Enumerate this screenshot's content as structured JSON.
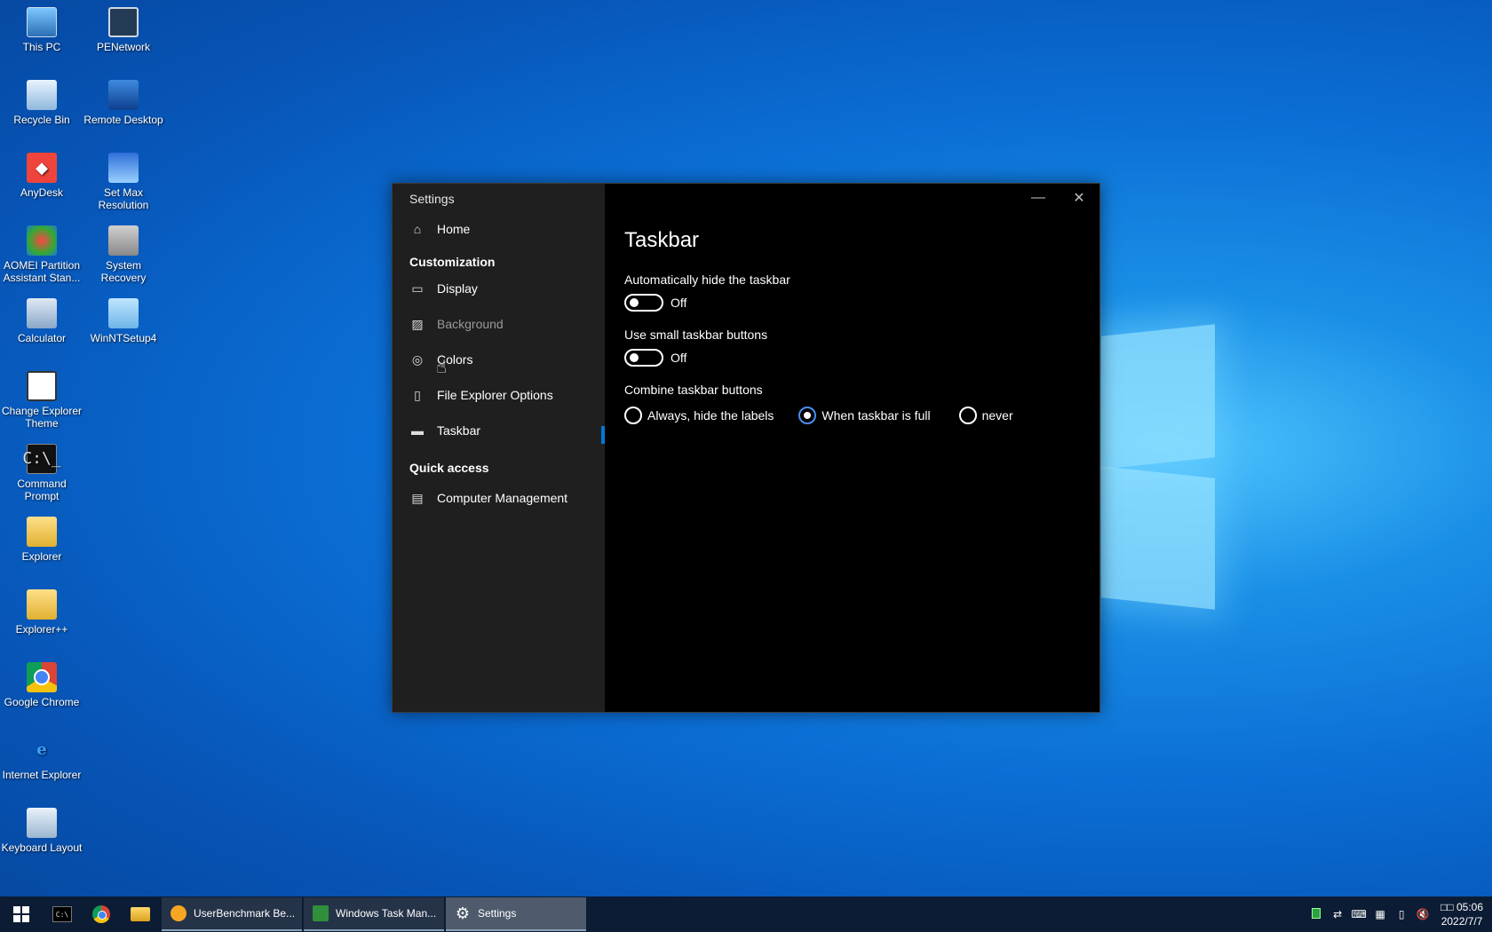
{
  "desktop": {
    "icons": [
      {
        "label": "This PC",
        "icon": "computer-icon"
      },
      {
        "label": "PENetwork",
        "icon": "network-icon"
      },
      {
        "label": "Recycle Bin",
        "icon": "recycle-bin-icon"
      },
      {
        "label": "Remote Desktop",
        "icon": "remote-desktop-icon"
      },
      {
        "label": "AnyDesk",
        "icon": "anydesk-icon"
      },
      {
        "label": "Set Max Resolution",
        "icon": "resolution-icon"
      },
      {
        "label": "AOMEI Partition Assistant Stan...",
        "icon": "partition-icon"
      },
      {
        "label": "System Recovery",
        "icon": "recovery-icon"
      },
      {
        "label": "Calculator",
        "icon": "calculator-icon"
      },
      {
        "label": "WinNTSetup4",
        "icon": "setup-icon"
      },
      {
        "label": "Change Explorer Theme",
        "icon": "theme-icon"
      },
      {
        "label": "Command Prompt",
        "icon": "cmd-icon"
      },
      {
        "label": "Explorer",
        "icon": "folder-icon"
      },
      {
        "label": "Explorer++",
        "icon": "folder-icon"
      },
      {
        "label": "Google Chrome",
        "icon": "chrome-icon"
      },
      {
        "label": "Internet Explorer",
        "icon": "ie-icon"
      },
      {
        "label": "Keyboard Layout",
        "icon": "keyboard-icon"
      }
    ]
  },
  "settings": {
    "window_title": "Settings",
    "nav": {
      "home": "Home",
      "customization_header": "Customization",
      "display": "Display",
      "background": "Background",
      "colors": "Colors",
      "file_explorer_options": "File Explorer Options",
      "taskbar": "Taskbar",
      "quick_access_header": "Quick access",
      "computer_management": "Computer Management"
    },
    "page": {
      "title": "Taskbar",
      "auto_hide_label": "Automatically hide the taskbar",
      "auto_hide_state": "Off",
      "small_buttons_label": "Use small taskbar buttons",
      "small_buttons_state": "Off",
      "combine_label": "Combine taskbar buttons",
      "combine_options": [
        "Always, hide the labels",
        "When taskbar is full",
        "never"
      ],
      "combine_selected": "When taskbar is full"
    },
    "accent_color": "#0078d7"
  },
  "taskbar": {
    "apps": [
      {
        "label": "UserBenchmark Be...",
        "active": false
      },
      {
        "label": "Windows Task Man...",
        "active": false
      },
      {
        "label": "Settings",
        "active": true
      }
    ],
    "clock_time": "05:06",
    "clock_prefix": "□□",
    "clock_date": "2022/7/7"
  }
}
